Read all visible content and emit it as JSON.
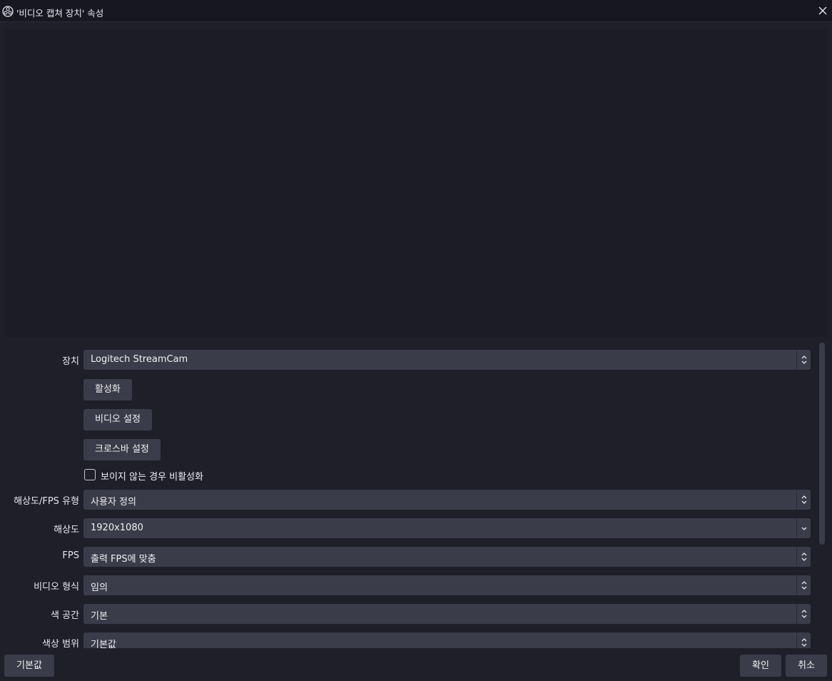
{
  "window": {
    "title": "'비디오 캡쳐 장치' 속성",
    "app_icon": "obs-logo-icon",
    "close_icon": "close-icon"
  },
  "properties": {
    "device_label": "장치",
    "device_value": "Logitech StreamCam",
    "activate_button": "활성화",
    "video_settings_button": "비디오 설정",
    "crossbar_settings_button": "크로스바 설정",
    "deactivate_checkbox_label": "보이지 않는 경우 비활성화",
    "deactivate_checked": false,
    "res_fps_type_label": "해상도/FPS 유형",
    "res_fps_type_value": "사용자 정의",
    "resolution_label": "해상도",
    "resolution_value": "1920x1080",
    "fps_label": "FPS",
    "fps_value": "출력 FPS에 맞춤",
    "video_format_label": "비디오 형식",
    "video_format_value": "임의",
    "color_space_label": "색 공간",
    "color_space_value": "기본",
    "color_range_label": "색상 범위",
    "color_range_value": "기본값"
  },
  "footer": {
    "defaults_button": "기본값",
    "ok_button": "확인",
    "cancel_button": "취소"
  },
  "colors": {
    "background": "#1e1f29",
    "control": "#3b3c4a",
    "titlebar": "#16171f"
  }
}
